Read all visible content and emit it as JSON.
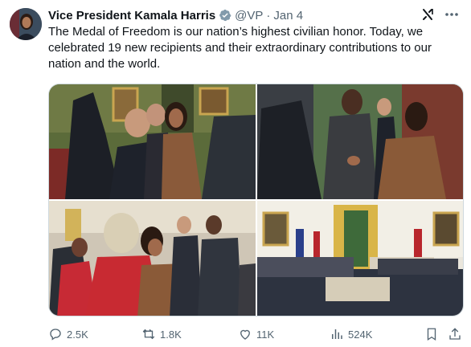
{
  "author": {
    "name": "Vice President Kamala Harris",
    "handle": "@VP",
    "separator": "·",
    "date": "Jan 4"
  },
  "post": {
    "text": "The Medal of Freedom is our nation’s highest civilian honor. Today, we celebrated 19 new recipients and their extraordinary contributions to our nation and the world."
  },
  "actions": {
    "replies": "2.5K",
    "reposts": "1.8K",
    "likes": "11K",
    "views": "524K"
  },
  "icons": {
    "verified": "verified-badge-icon",
    "grok": "grok-icon",
    "more": "more-icon",
    "reply": "reply-icon",
    "repost": "repost-icon",
    "like": "heart-icon",
    "views": "views-icon",
    "bookmark": "bookmark-icon",
    "share": "share-icon"
  },
  "colors": {
    "secondary_text": "#536471",
    "verified_badge": "#829aab",
    "border": "#cfd9de"
  }
}
